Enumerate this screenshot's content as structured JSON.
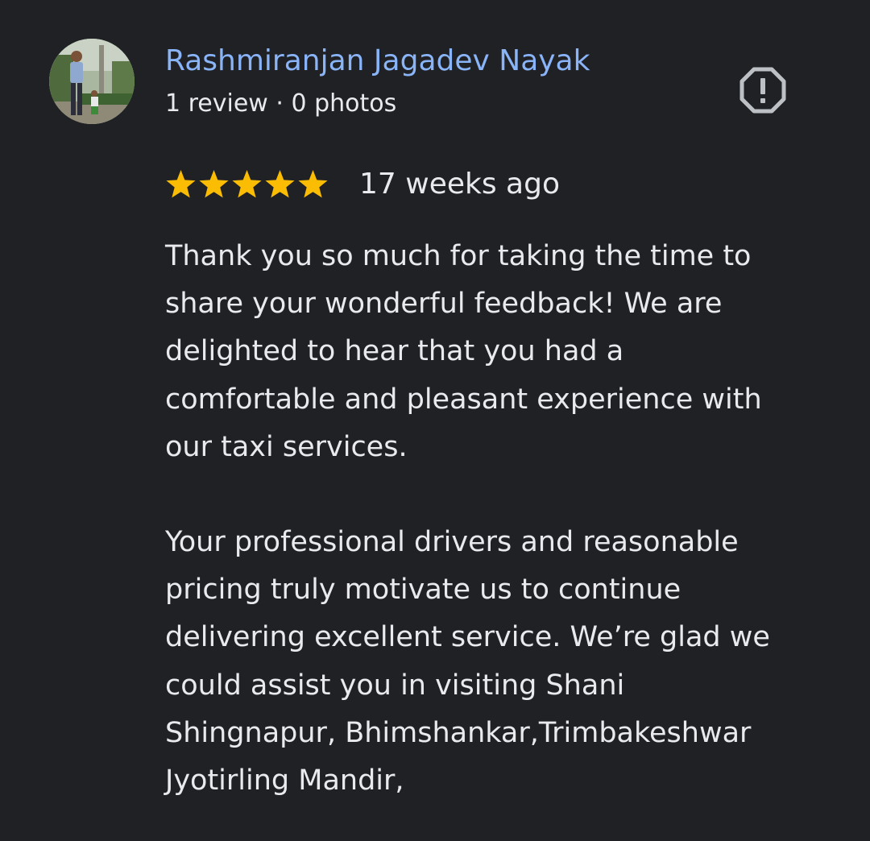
{
  "review": {
    "author": {
      "name": "Rashmiranjan Jagadev Nayak",
      "meta": "1 review · 0 photos",
      "avatar_icon": "user-photo-avatar"
    },
    "report_icon": "report-octagon-exclamation-icon",
    "rating": {
      "stars": 5,
      "max": 5,
      "color": "#fbbc04"
    },
    "date": "17 weeks ago",
    "paragraphs": [
      "Thank you so much for taking the time to\nshare your wonderful feedback! We are\ndelighted to hear that you had a\ncomfortable and pleasant experience with\nour taxi services.",
      "Your professional drivers and reasonable\npricing truly motivate us to continue\ndelivering excellent service. We’re glad we\ncould assist you in visiting Shani\nShingnapur, Bhimshankar,Trimbakeshwar\nJyotirling Mandir,"
    ]
  },
  "colors": {
    "background": "#202124",
    "name": "#8ab4f8",
    "text": "#e8eaed",
    "icon": "#bdc1c6",
    "star": "#fbbc04"
  }
}
